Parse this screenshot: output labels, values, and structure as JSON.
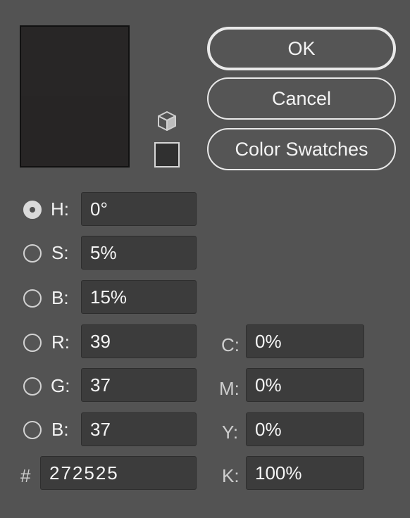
{
  "preview": {
    "new_color": "#282626",
    "current_color": "#272525"
  },
  "icons": {
    "gamut_warning": "cube-icon",
    "websafe_swatch": "#303030"
  },
  "buttons": {
    "ok": "OK",
    "cancel": "Cancel",
    "swatches": "Color Swatches"
  },
  "hsb": [
    {
      "label": "H:",
      "value": "0°",
      "selected": true
    },
    {
      "label": "S:",
      "value": "5%",
      "selected": false
    },
    {
      "label": "B:",
      "value": "15%",
      "selected": false
    }
  ],
  "rgb": [
    {
      "label": "R:",
      "value": "39",
      "selected": false
    },
    {
      "label": "G:",
      "value": "37",
      "selected": false
    },
    {
      "label": "B:",
      "value": "37",
      "selected": false
    }
  ],
  "cmyk": [
    {
      "label": "C:",
      "value": "0%"
    },
    {
      "label": "M:",
      "value": "0%"
    },
    {
      "label": "Y:",
      "value": "0%"
    },
    {
      "label": "K:",
      "value": "100%"
    }
  ],
  "hex": {
    "label": "#",
    "value": "272525"
  }
}
